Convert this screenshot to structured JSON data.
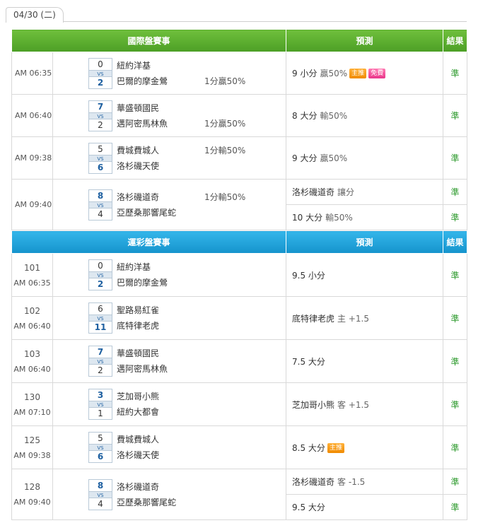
{
  "date_tab": "04/30 (二)",
  "table1": {
    "header": {
      "title": "國際盤賽事",
      "pred": "預測",
      "result": "結果"
    },
    "rows": [
      {
        "time": "AM 06:35",
        "s1": "0",
        "s2": "2",
        "team1": "紐約洋基",
        "team2": "巴爾的摩金鶯",
        "hc": "1分贏50%",
        "hc_row": 2,
        "preds": [
          {
            "main": "9 小分",
            "sub": "贏50%",
            "badges": [
              "主推",
              "免費"
            ],
            "res": "準"
          }
        ]
      },
      {
        "time": "AM 06:40",
        "s1": "7",
        "s2": "2",
        "team1": "華盛頓國民",
        "team2": "邁阿密馬林魚",
        "hc": "1分贏50%",
        "hc_row": 2,
        "preds": [
          {
            "main": "8 大分",
            "sub": "輸50%",
            "badges": [],
            "res": "準"
          }
        ]
      },
      {
        "time": "AM 09:38",
        "s1": "5",
        "s2": "6",
        "team1": "費城費城人",
        "team2": "洛杉磯天使",
        "hc": "1分輸50%",
        "hc_row": 1,
        "preds": [
          {
            "main": "9 大分",
            "sub": "贏50%",
            "badges": [],
            "res": "準"
          }
        ]
      },
      {
        "time": "AM 09:40",
        "s1": "8",
        "s2": "4",
        "team1": "洛杉磯道奇",
        "team2": "亞歷桑那響尾蛇",
        "hc": "1分輸50%",
        "hc_row": 1,
        "preds": [
          {
            "main": "洛杉磯道奇",
            "sub": "讓分",
            "badges": [],
            "res": "準"
          },
          {
            "main": "10 大分",
            "sub": "輸50%",
            "badges": [],
            "res": "準"
          }
        ]
      }
    ]
  },
  "table2": {
    "header": {
      "title": "運彩盤賽事",
      "pred": "預測",
      "result": "結果"
    },
    "rows": [
      {
        "no": "101",
        "time": "AM 06:35",
        "s1": "0",
        "s2": "2",
        "team1": "紐約洋基",
        "team2": "巴爾的摩金鶯",
        "preds": [
          {
            "main": "9.5 小分",
            "sub": "",
            "badges": [],
            "res": "準"
          }
        ]
      },
      {
        "no": "102",
        "time": "AM 06:40",
        "s1": "6",
        "s2": "11",
        "team1": "聖路易紅雀",
        "team2": "底特律老虎",
        "preds": [
          {
            "main": "底特律老虎",
            "sub": "主 +1.5",
            "badges": [],
            "res": "準"
          }
        ]
      },
      {
        "no": "103",
        "time": "AM 06:40",
        "s1": "7",
        "s2": "2",
        "team1": "華盛頓國民",
        "team2": "邁阿密馬林魚",
        "preds": [
          {
            "main": "7.5 大分",
            "sub": "",
            "badges": [],
            "res": "準"
          }
        ]
      },
      {
        "no": "130",
        "time": "AM 07:10",
        "s1": "3",
        "s2": "1",
        "team1": "芝加哥小熊",
        "team2": "紐約大都會",
        "preds": [
          {
            "main": "芝加哥小熊",
            "sub": "客 +1.5",
            "badges": [],
            "res": "準"
          }
        ]
      },
      {
        "no": "125",
        "time": "AM 09:38",
        "s1": "5",
        "s2": "6",
        "team1": "費城費城人",
        "team2": "洛杉磯天使",
        "preds": [
          {
            "main": "8.5 大分",
            "sub": "",
            "badges": [
              "主推"
            ],
            "res": "準"
          }
        ]
      },
      {
        "no": "128",
        "time": "AM 09:40",
        "s1": "8",
        "s2": "4",
        "team1": "洛杉磯道奇",
        "team2": "亞歷桑那響尾蛇",
        "preds": [
          {
            "main": "洛杉磯道奇",
            "sub": "客 -1.5",
            "badges": [],
            "res": "準"
          },
          {
            "main": "9.5 大分",
            "sub": "",
            "badges": [],
            "res": "準"
          }
        ]
      }
    ]
  }
}
